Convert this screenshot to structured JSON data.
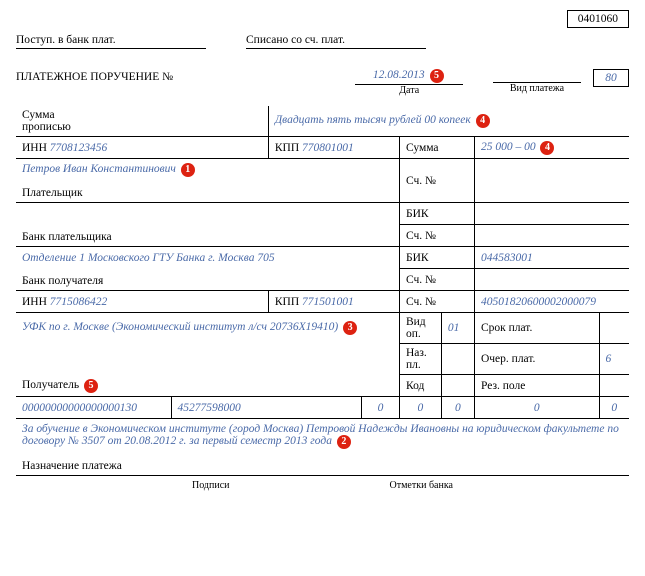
{
  "form_number": "0401060",
  "top": {
    "left_label": "Поступ. в банк плат.",
    "right_label": "Списано со сч. плат."
  },
  "title": "ПЛАТЕЖНОЕ ПОРУЧЕНИЕ №",
  "date": "12.08.2013",
  "date_label": "Дата",
  "payment_type_label": "Вид платежа",
  "payment_type": "80",
  "sum_words_label1": "Сумма",
  "sum_words_label2": "прописью",
  "sum_words": "Двадцать пять тысяч рублей 00 копеек",
  "payer": {
    "inn_label": "ИНН",
    "inn": "7708123456",
    "kpp_label": "КПП",
    "kpp": "770801001",
    "name": "Петров Иван Константинович",
    "label": "Плательщик",
    "bank_label": "Банк плательщика"
  },
  "sum_label": "Сумма",
  "sum": "25 000 – 00",
  "acc_label": "Сч. №",
  "bik_label": "БИК",
  "recip_bank": {
    "name": "Отделение 1 Московского ГТУ Банка г. Москва 705",
    "label": "Банк получателя",
    "bik": "044583001"
  },
  "recipient": {
    "inn_label": "ИНН",
    "inn": "7715086422",
    "kpp_label": "КПП",
    "kpp": "771501001",
    "acc": "40501820600002000079",
    "name": "УФК по г. Москве (Экономический институт л/сч 20736Х19410)",
    "label": "Получатель"
  },
  "op": {
    "vid_label": "Вид оп.",
    "vid": "01",
    "naz_label": "Наз. пл.",
    "kod_label": "Код",
    "srok_label": "Срок плат.",
    "ocher_label": "Очер. плат.",
    "ocher": "6",
    "rez_label": "Рез. поле"
  },
  "codes": {
    "c1": "00000000000000000130",
    "c2": "45277598000",
    "c3": "0",
    "c4": "0",
    "c5": "0",
    "c6": "0",
    "c7": "0"
  },
  "purpose": "За обучение в Экономическом институте (город Москва) Петровой Надежды Ивановны на юридическом факультете по договору № 3507 от 20.08.2012 г. за первый семестр 2013 года",
  "purpose_label": "Назначение платежа",
  "footer": {
    "sign": "Подписи",
    "bank": "Отметки банка"
  },
  "badges": {
    "b1": "1",
    "b2": "2",
    "b3": "3",
    "b4": "4",
    "b5": "5"
  }
}
